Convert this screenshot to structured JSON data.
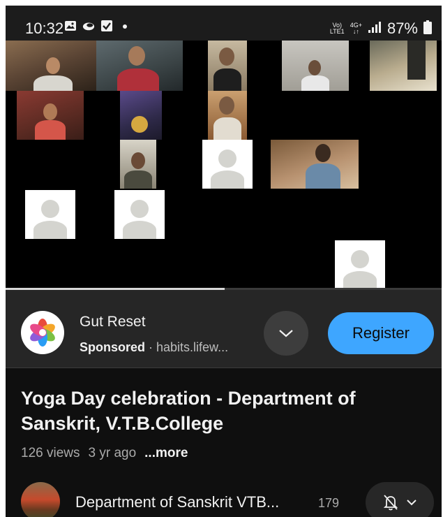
{
  "status_bar": {
    "time": "10:32",
    "volte": "Vo)",
    "lte": "LTE1",
    "network": "4G+",
    "battery": "87%"
  },
  "video": {
    "progress": 0.503
  },
  "ad": {
    "title": "Gut Reset",
    "sponsored": "Sponsored",
    "separator": " · ",
    "domain": "habits.lifew...",
    "cta": "Register"
  },
  "video_info": {
    "title": "Yoga Day celebration - Department of Sanskrit, V.T.B.College",
    "views": "126 views",
    "age": "3 yr ago",
    "more": "...more"
  },
  "channel": {
    "name": "Department of Sanskrit VTB...",
    "subscribers": "179"
  },
  "colors": {
    "accent": "#3ea6ff",
    "background": "#0f0f0f",
    "card": "#262626"
  }
}
